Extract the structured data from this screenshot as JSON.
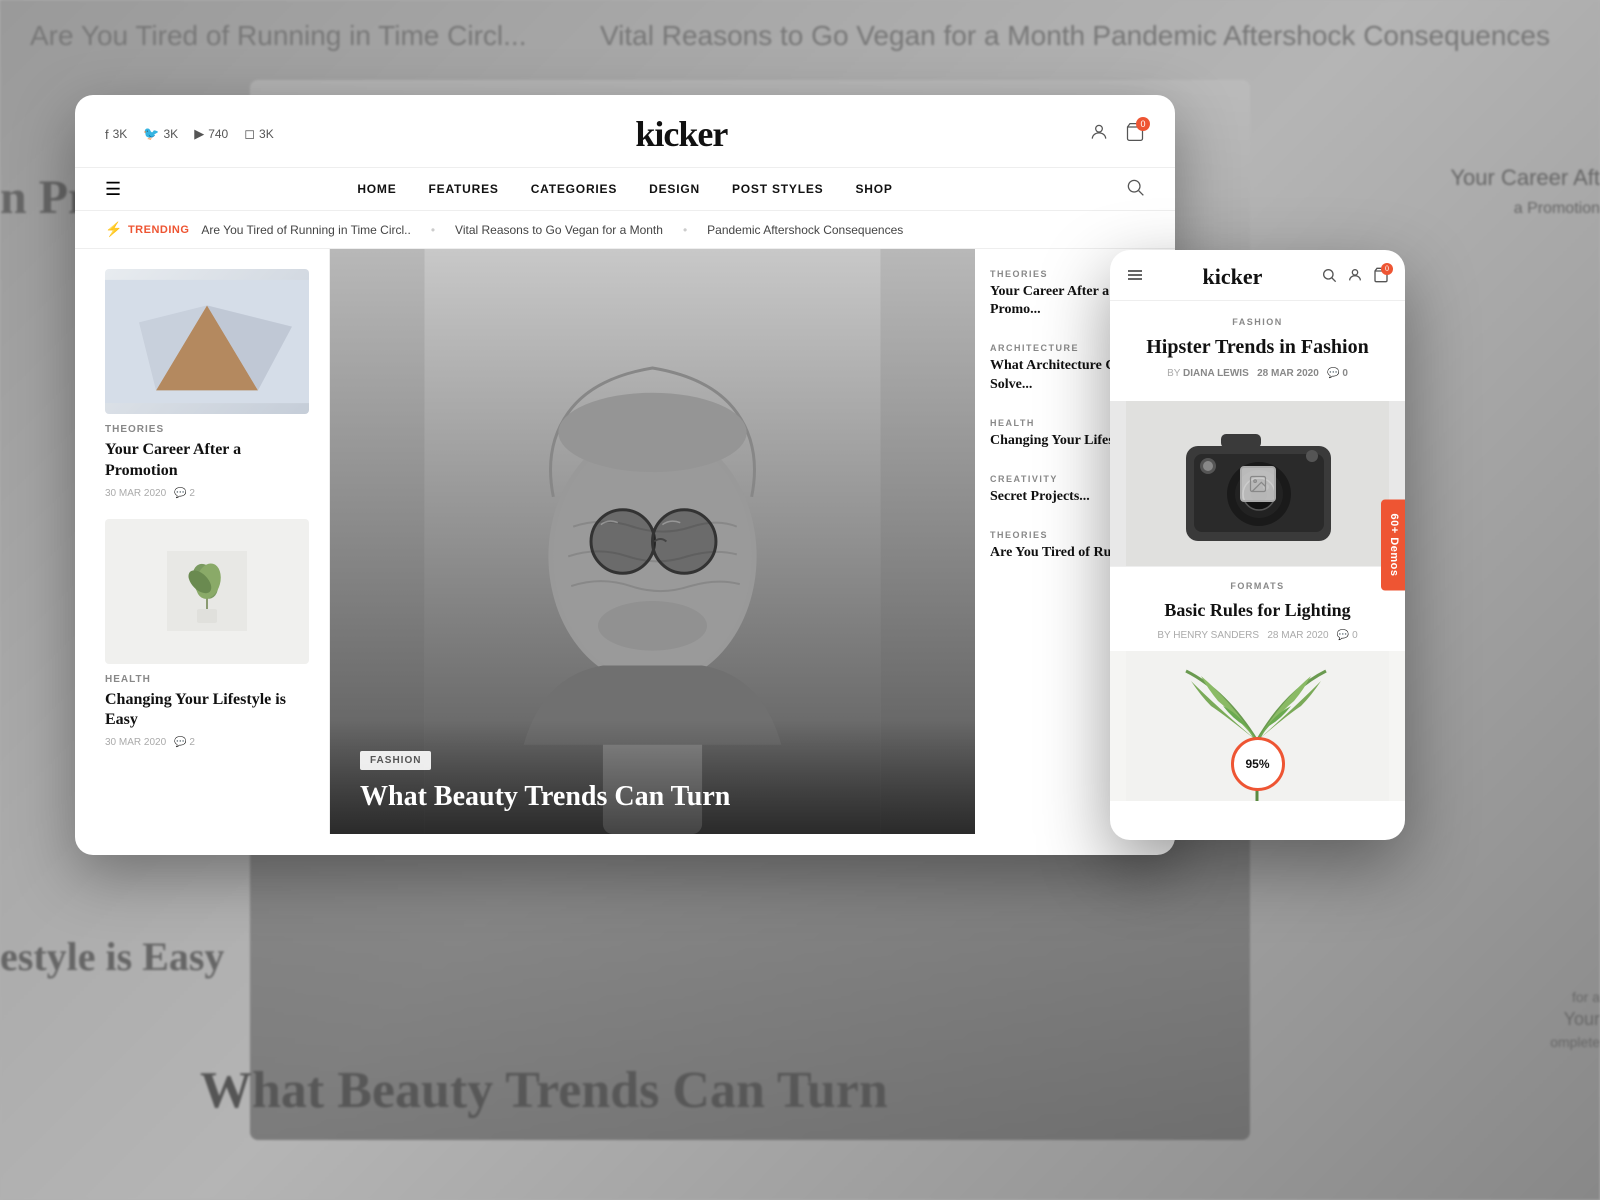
{
  "site": {
    "name": "kicker",
    "logo": "kicker"
  },
  "background": {
    "texts": [
      "Are You Tired of Running in Time Circl...",
      "Vital Reasons to Go Vegan for a Month",
      "Pandemic Aftershock Consequences",
      "n Prom",
      "estyle is Easy",
      "Your Career Aft",
      "What Beauty Trends Can Turn"
    ]
  },
  "header": {
    "social": [
      {
        "icon": "f",
        "count": "3K"
      },
      {
        "icon": "🐦",
        "count": "3K"
      },
      {
        "icon": "▶",
        "count": "740"
      },
      {
        "icon": "◻",
        "count": "3K"
      }
    ],
    "cart_count": "0"
  },
  "nav": {
    "links": [
      "HOME",
      "FEATURES",
      "CATEGORIES",
      "DESIGN",
      "POST STYLES",
      "SHOP"
    ]
  },
  "trending": {
    "label": "TRENDING",
    "items": [
      "Are You Tired of Running in Time Circl..",
      "Vital Reasons to Go Vegan for a Month",
      "Pandemic Aftershock Consequences"
    ]
  },
  "articles_left": [
    {
      "category": "THEORIES",
      "title": "Your Career After a Promotion",
      "date": "30 MAR 2020",
      "comments": "2",
      "img_type": "triangle"
    },
    {
      "category": "HEALTH",
      "title": "Changing Your Lifestyle is Easy",
      "date": "30 MAR 2020",
      "comments": "2",
      "img_type": "plant"
    }
  ],
  "center_article": {
    "category": "FASHION",
    "title": "What Beauty Trends Can Turn"
  },
  "right_sidebar": {
    "sections": [
      {
        "category": "THEORIES",
        "title": "Your Career After a Promo..."
      },
      {
        "category": "ARCHITECTURE",
        "title": "What Architecture Can Solve..."
      },
      {
        "category": "HEALTH",
        "title": "Changing Your Lifest..."
      },
      {
        "category": "CREATIVITY",
        "title": "Secret Projects..."
      },
      {
        "category": "THEORIES",
        "title": "Are You Tired of Runn..."
      }
    ]
  },
  "mobile": {
    "logo": "kicker",
    "demos_tab": "60+ Demos",
    "featured": {
      "category": "FASHION",
      "title": "Hipster Trends in Fashion",
      "author": "DIANA LEWIS",
      "date": "28 MAR 2020",
      "comments": "0"
    },
    "second": {
      "category": "FORMATS",
      "title": "Basic Rules for Lighting",
      "author": "HENRY SANDERS",
      "date": "28 MAR 2020",
      "comments": "0"
    },
    "progress": "95%"
  }
}
